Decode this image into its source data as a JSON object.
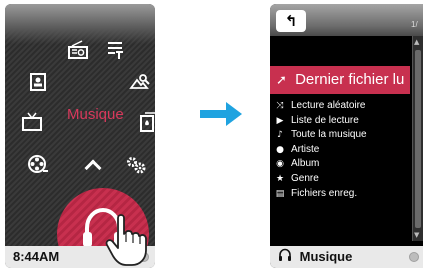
{
  "left_screen": {
    "center_label": "Musique",
    "status_time": "8:44AM",
    "icons": [
      "radio-icon",
      "text-list-icon",
      "contact-card-icon",
      "camera-icon",
      "tv-icon",
      "cards-icon",
      "film-reel-icon",
      "gears-icon",
      "up-chevron-icon",
      "headphones-icon"
    ]
  },
  "right_screen": {
    "back_symbol": "↰",
    "page_count": "1/",
    "selected_item": {
      "icon": "arrow-icon",
      "label": "Dernier fichier lu"
    },
    "items": [
      {
        "icon": "shuffle-icon",
        "label": "Lecture aléatoire"
      },
      {
        "icon": "playlist-icon",
        "label": "Liste de lecture"
      },
      {
        "icon": "note-icon",
        "label": "Toute la musique"
      },
      {
        "icon": "artist-icon",
        "label": "Artiste"
      },
      {
        "icon": "album-icon",
        "label": "Album"
      },
      {
        "icon": "star-icon",
        "label": "Genre"
      },
      {
        "icon": "file-icon",
        "label": "Fichiers enreg."
      }
    ],
    "status_label": "Musique"
  },
  "colors": {
    "accent": "#c8304f",
    "arrow": "#1fa3e0",
    "label_pink": "#d8395c"
  }
}
